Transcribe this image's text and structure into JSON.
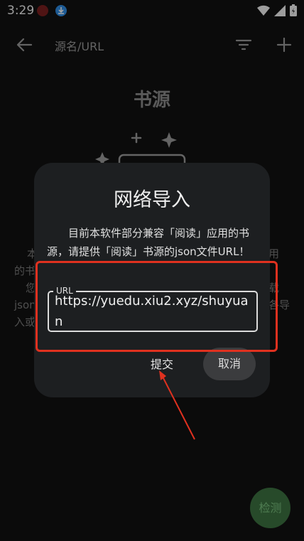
{
  "status_bar": {
    "time": "3:29"
  },
  "appbar": {
    "title": "源名/URL"
  },
  "empty_state": {
    "title": "书源",
    "left_fragments": [
      "本",
      "的书",
      "您",
      "json",
      "入或"
    ],
    "right_fragments": [
      "用",
      "",
      "载",
      "各导",
      ""
    ]
  },
  "dialog": {
    "title": "网络导入",
    "message": "目前本软件部分兼容「阅读」应用的书源，请提供「阅读」书源的json文件URL！",
    "url_label": "URL",
    "url_value": "https://yuedu.xiu2.xyz/shuyuan",
    "submit_label": "提交",
    "cancel_label": "取消"
  },
  "fab": {
    "label": "检测"
  },
  "colors": {
    "background": "#111111",
    "dialog": "#1d1f21",
    "annotation": "#e0311f",
    "fab": "#274a2a"
  }
}
